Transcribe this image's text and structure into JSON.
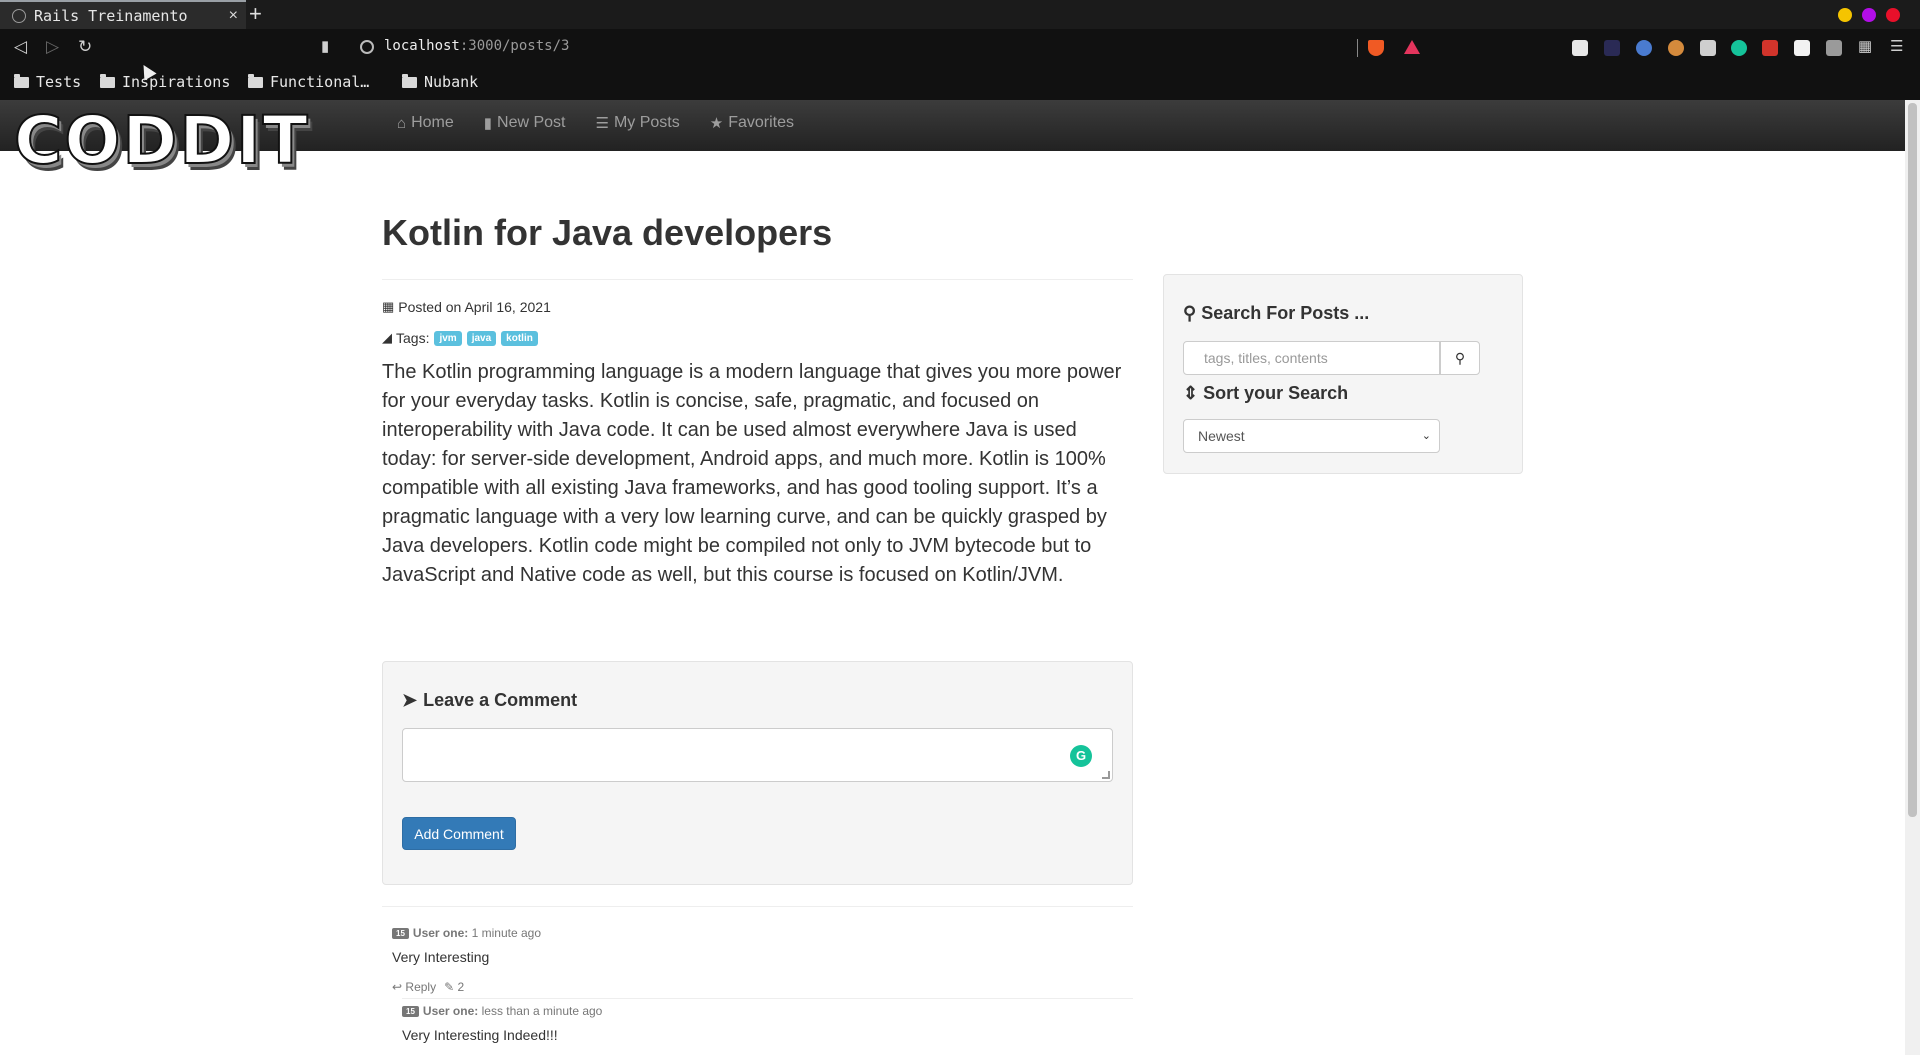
{
  "browser": {
    "tab_title": "Rails Treinamento",
    "tab_close": "×",
    "new_tab": "+",
    "url_host": "localhost",
    "url_path": ":3000/posts/3",
    "bookmarks": [
      "Tests",
      "Inspirations",
      "Functional…",
      "Nubank"
    ],
    "window_button_colors": [
      "#f5c400",
      "#b30ee8",
      "#e8102a"
    ]
  },
  "site": {
    "logo": "CODDIT",
    "menu": [
      {
        "icon": "home-icon",
        "label": "Home"
      },
      {
        "icon": "book-icon",
        "label": "New Post"
      },
      {
        "icon": "list-icon",
        "label": "My Posts"
      },
      {
        "icon": "star-icon",
        "label": "Favorites"
      }
    ]
  },
  "post": {
    "title": "Kotlin for Java developers",
    "posted_on": "Posted on April 16, 2021",
    "tags_label": "Tags:",
    "tags": [
      "jvm",
      "java",
      "kotlin"
    ],
    "content": "The Kotlin programming language is a modern language that gives you more power for your everyday tasks. Kotlin is concise, safe, pragmatic, and focused on interoperability with Java code. It can be used almost everywhere Java is used today: for server-side development, Android apps, and much more. Kotlin is 100% compatible with all existing Java frameworks, and has good tooling support. It’s a pragmatic language with a very low learning curve, and can be quickly grasped by Java developers. Kotlin code might be compiled not only to JVM bytecode but to JavaScript and Native code as well, but this course is focused on Kotlin/JVM."
  },
  "comment_form": {
    "heading": "Leave a Comment",
    "button": "Add Comment"
  },
  "comments": [
    {
      "badge": "15",
      "user": "User one:",
      "time": "1 minute ago",
      "body": "Very Interesting",
      "reply": "Reply",
      "count": "2"
    },
    {
      "badge": "15",
      "user": "User one:",
      "time": "less than a minute ago",
      "body": "Very Interesting Indeed!!!"
    }
  ],
  "sidebar": {
    "search_heading": "Search For Posts ...",
    "search_placeholder": "tags, titles, contents",
    "sort_heading": "Sort your Search",
    "sort_selected": "Newest"
  },
  "colors": {
    "tag": "#5bc0de",
    "primary_button": "#337ab7",
    "grammarly": "#15c39a"
  }
}
